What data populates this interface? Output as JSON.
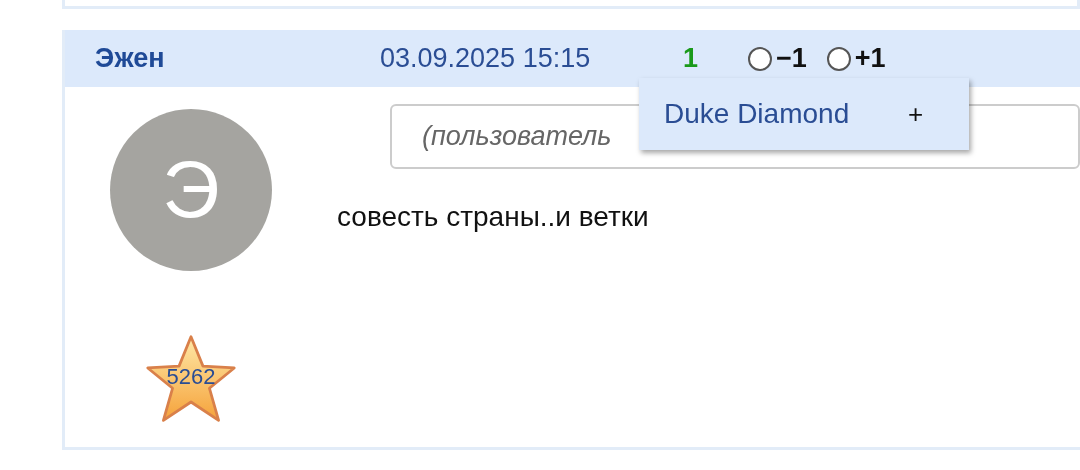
{
  "post": {
    "author": "Эжен",
    "date": "03.09.2025 15:15",
    "score": "1",
    "votes": [
      {
        "label": "−1",
        "selected": false
      },
      {
        "label": "+1",
        "selected": false
      }
    ],
    "avatar_letter": "Э",
    "reply_field": {
      "placeholder": "(пользователь"
    },
    "text": "совесть страны..и ветки",
    "rating": "5262"
  },
  "popup": {
    "items": [
      {
        "label": "Duke Diamond",
        "action": "+"
      }
    ]
  }
}
